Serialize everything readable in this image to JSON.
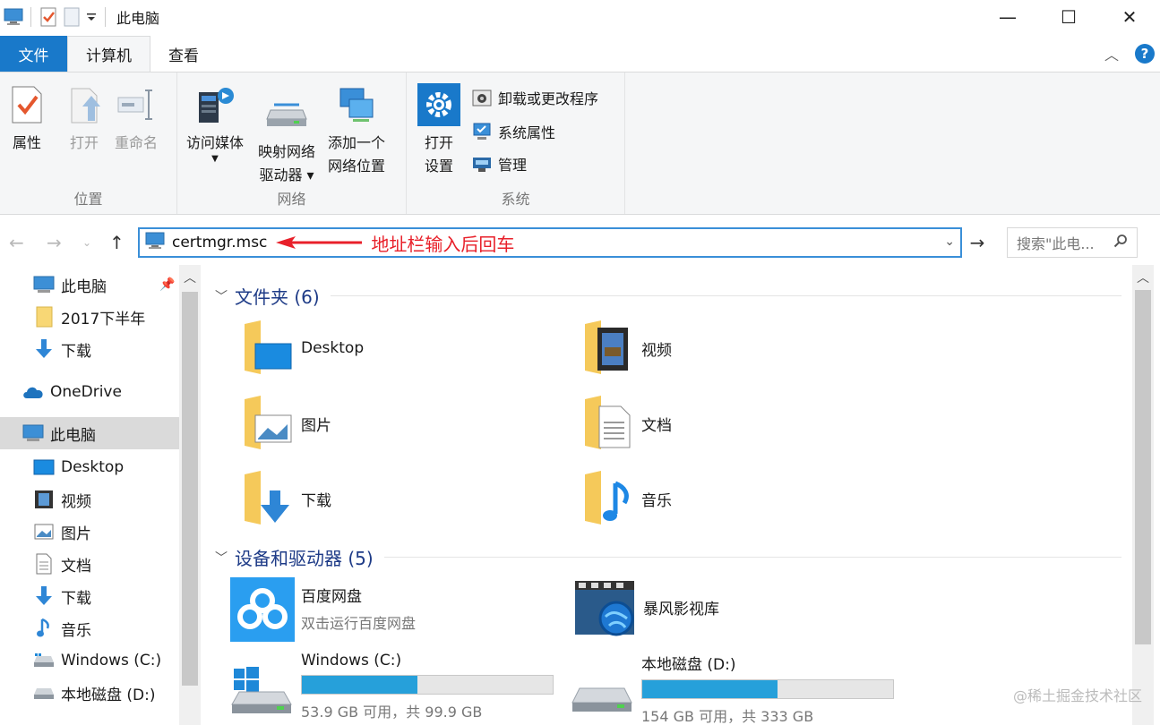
{
  "window": {
    "title": "此电脑",
    "minimize": "—",
    "maximize": "☐",
    "close": "✕"
  },
  "ribbon_tabs": [
    "文件",
    "计算机",
    "查看"
  ],
  "ribbon": {
    "location_group": {
      "label": "位置",
      "properties": "属性",
      "open": "打开",
      "rename": "重命名"
    },
    "network_group": {
      "label": "网络",
      "access_media": "访问媒体",
      "map_drive_1": "映射网络",
      "map_drive_2": "驱动器",
      "add_location_1": "添加一个",
      "add_location_2": "网络位置"
    },
    "system_group": {
      "label": "系统",
      "open_settings_1": "打开",
      "open_settings_2": "设置",
      "uninstall": "卸载或更改程序",
      "sys_props": "系统属性",
      "manage": "管理"
    }
  },
  "address": {
    "value": "certmgr.msc",
    "annotation": "地址栏输入后回车",
    "search_placeholder": "搜索\"此电...",
    "dropdown": "⌄",
    "go": "→"
  },
  "sidebar": {
    "items": [
      {
        "label": "此电脑",
        "icon": "pc-icon"
      },
      {
        "label": "2017下半年",
        "icon": "folder-icon"
      },
      {
        "label": "下载",
        "icon": "download-icon"
      },
      {
        "label": "OneDrive",
        "icon": "cloud-icon"
      },
      {
        "label": "此电脑",
        "icon": "pc-icon"
      },
      {
        "label": "Desktop",
        "icon": "desktop-icon"
      },
      {
        "label": "视频",
        "icon": "video-icon"
      },
      {
        "label": "图片",
        "icon": "picture-icon"
      },
      {
        "label": "文档",
        "icon": "document-icon"
      },
      {
        "label": "下载",
        "icon": "download-icon"
      },
      {
        "label": "音乐",
        "icon": "music-icon"
      },
      {
        "label": "Windows (C:)",
        "icon": "drive-icon"
      },
      {
        "label": "本地磁盘 (D:)",
        "icon": "drive-icon"
      }
    ]
  },
  "folders": {
    "header": "文件夹 (6)",
    "items": [
      "Desktop",
      "视频",
      "图片",
      "文档",
      "下载",
      "音乐"
    ]
  },
  "devices": {
    "header": "设备和驱动器 (5)",
    "baidu": {
      "name": "百度网盘",
      "sub": "双击运行百度网盘"
    },
    "storm": {
      "name": "暴风影视库"
    },
    "drive_c": {
      "name": "Windows (C:)",
      "space": "53.9 GB 可用，共 99.9 GB",
      "used_fraction": 0.46
    },
    "drive_d": {
      "name": "本地磁盘 (D:)",
      "space": "154 GB 可用，共 333 GB",
      "used_fraction": 0.54
    }
  },
  "watermark": "@稀土掘金技术社区",
  "colors": {
    "accent": "#1979ca",
    "bar": "#26a0da",
    "annotation": "#e8202a",
    "header": "#1e3b87"
  }
}
